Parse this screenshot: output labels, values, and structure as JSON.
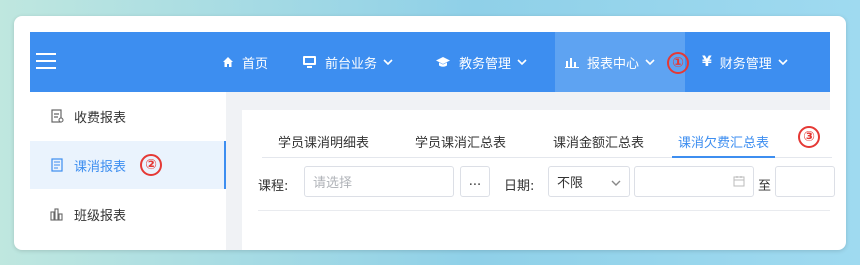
{
  "topnav": {
    "items": [
      {
        "label": "首页",
        "icon": "home-icon"
      },
      {
        "label": "前台业务",
        "icon": "monitor-icon"
      },
      {
        "label": "教务管理",
        "icon": "graduation-cap-icon"
      },
      {
        "label": "报表中心",
        "icon": "bar-chart-icon"
      },
      {
        "label": "财务管理",
        "icon": "yen-icon"
      }
    ],
    "active_index": 3,
    "accent_color": "#3d8ef0"
  },
  "sidebar": {
    "items": [
      {
        "label": "收费报表",
        "icon": "receipt-icon"
      },
      {
        "label": "课消报表",
        "icon": "document-icon"
      },
      {
        "label": "班级报表",
        "icon": "chart-bars-icon"
      }
    ],
    "active_index": 1
  },
  "tabs": {
    "items": [
      "学员课消明细表",
      "学员课消汇总表",
      "课消金额汇总表",
      "课消欠费汇总表"
    ],
    "active_index": 3
  },
  "filters": {
    "course_label": "课程:",
    "course_placeholder": "请选择",
    "ellipsis_button": "...",
    "date_label": "日期:",
    "date_range_value": "不限",
    "to_label": "至"
  },
  "annotations": [
    "①",
    "②",
    "③"
  ],
  "annotation_color": "#e53935"
}
